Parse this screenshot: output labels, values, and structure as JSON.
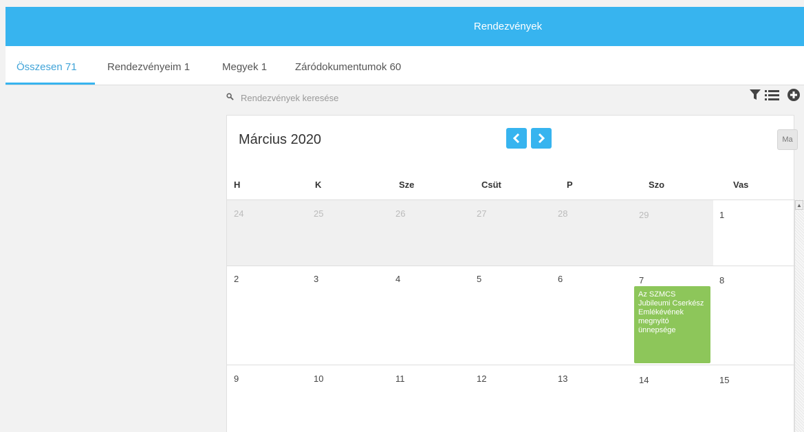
{
  "header": {
    "title": "Rendezvények"
  },
  "tabs": [
    {
      "label": "Összesen 71",
      "active": true
    },
    {
      "label": "Rendezvényeim 1",
      "active": false
    },
    {
      "label": "Megyek 1",
      "active": false
    },
    {
      "label": "Záródokumentumok 60",
      "active": false
    }
  ],
  "search": {
    "placeholder": "Rendezvények keresése"
  },
  "toolbar": {
    "icons": [
      "filter-icon",
      "list-icon",
      "add-circle-icon"
    ]
  },
  "calendar": {
    "title": "Március 2020",
    "today_label": "Ma",
    "weekdays": [
      "H",
      "K",
      "Sze",
      "Csüt",
      "P",
      "Szo",
      "Vas"
    ],
    "weeks": [
      [
        "24",
        "25",
        "26",
        "27",
        "28",
        "29",
        "1"
      ],
      [
        "2",
        "3",
        "4",
        "5",
        "6",
        "7",
        "8"
      ],
      [
        "9",
        "10",
        "11",
        "12",
        "13",
        "14",
        "15"
      ]
    ],
    "event": {
      "day": "7",
      "title": "Az SZMCS Jubileumi Cserkész Emlékévének megnyitó ünnepsége",
      "color": "#8dc65a"
    }
  },
  "colors": {
    "accent": "#37b4ef",
    "event": "#8dc65a"
  }
}
